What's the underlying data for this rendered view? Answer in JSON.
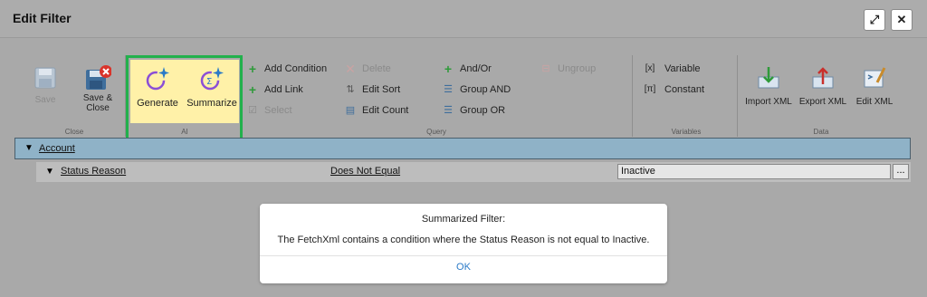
{
  "title": "Edit Filter",
  "window": {
    "maximize_glyph": "⤢",
    "close_glyph": "✕"
  },
  "groups": {
    "close": "Close",
    "ai": "AI",
    "query": "Query",
    "variables": "Variables",
    "data": "Data"
  },
  "buttons": {
    "save": "Save",
    "save_close_1": "Save &",
    "save_close_2": "Close",
    "generate": "Generate",
    "summarize": "Summarize",
    "add_condition": "Add Condition",
    "add_link": "Add Link",
    "select": "Select",
    "delete": "Delete",
    "edit_sort": "Edit Sort",
    "edit_count": "Edit Count",
    "and_or": "And/Or",
    "group_and": "Group AND",
    "group_or": "Group OR",
    "ungroup": "Ungroup",
    "variable": "Variable",
    "variable_prefix": "[x]",
    "constant": "Constant",
    "constant_prefix": "[π]",
    "import_xml": "Import XML",
    "export_xml": "Export XML",
    "edit_xml": "Edit XML"
  },
  "tree": {
    "entity": "Account",
    "condition": {
      "field": "Status Reason",
      "operator": "Does Not Equal",
      "value": "Inactive",
      "ellipsis": "..."
    }
  },
  "modal": {
    "title": "Summarized Filter:",
    "message": "The FetchXml contains a condition where the Status Reason is not equal to Inactive.",
    "ok": "OK"
  },
  "colors": {
    "ai_highlight_border": "#22b14c",
    "ai_button_bg": "#fff1a8",
    "tree_header_bg": "#8fb2c7",
    "link_blue": "#2a7ac7"
  }
}
